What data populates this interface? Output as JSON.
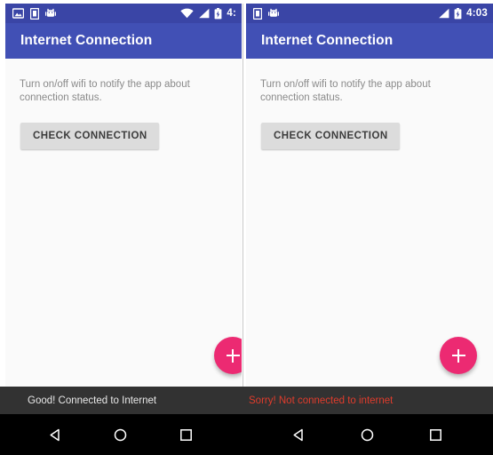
{
  "app": {
    "title": "Internet Connection",
    "body_text": "Turn on/off wifi to notify the app about connection status.",
    "check_button_label": "CHECK CONNECTION",
    "fab_icon": "plus-icon",
    "appbar_color": "#4150b5",
    "statusbar_color": "#3a45a6",
    "fab_color": "#ec2a72",
    "content_background": "#fafafa"
  },
  "panels": [
    {
      "id": "connected",
      "title": "Internet Connection",
      "body_text": "Turn on/off wifi to notify the app about connection status.",
      "check_button_label": "CHECK CONNECTION",
      "statusbar": {
        "time": "4:",
        "notification_icons": [
          "image-icon",
          "sd-card-icon",
          "android-robot-icon"
        ],
        "system_icons": [
          "wifi-icon",
          "signal-icon",
          "battery-charging-icon"
        ]
      },
      "snackbar": {
        "message": "Good! Connected to Internet",
        "text_color": "#e8e8e8",
        "background": "#323232"
      }
    },
    {
      "id": "disconnected",
      "title": "Internet Connection",
      "body_text": "Turn on/off wifi to notify the app about connection status.",
      "check_button_label": "CHECK CONNECTION",
      "statusbar": {
        "time": "4:03",
        "notification_icons": [
          "sd-card-icon",
          "android-robot-icon"
        ],
        "system_icons": [
          "signal-icon",
          "battery-charging-icon"
        ]
      },
      "snackbar": {
        "message": "Sorry! Not connected to internet",
        "text_color": "#e03c2c",
        "background": "#323232"
      }
    }
  ],
  "navigation_bar": {
    "background": "#000000",
    "buttons": [
      {
        "name": "back-button",
        "icon": "triangle-back-icon"
      },
      {
        "name": "home-button",
        "icon": "circle-home-icon"
      },
      {
        "name": "recents-button",
        "icon": "square-recents-icon"
      }
    ]
  }
}
